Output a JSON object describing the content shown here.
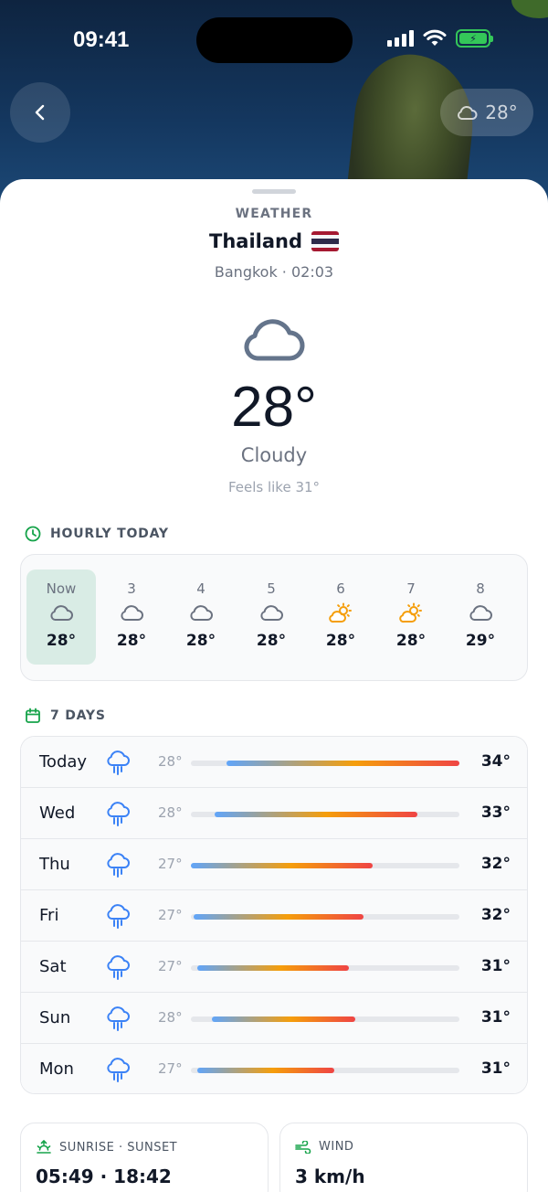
{
  "status_bar": {
    "time": "09:41"
  },
  "header": {
    "chip_temp": "28°"
  },
  "location": {
    "section_label": "WEATHER",
    "country": "Thailand",
    "city_time": "Bangkok · 02:03"
  },
  "current": {
    "temp": "28°",
    "condition": "Cloudy",
    "feels_like": "Feels like 31°"
  },
  "hourly": {
    "title": "HOURLY TODAY",
    "items": [
      {
        "label": "Now",
        "icon": "cloud-icon",
        "temp": "28°"
      },
      {
        "label": "3",
        "icon": "cloud-icon",
        "temp": "28°"
      },
      {
        "label": "4",
        "icon": "cloud-icon",
        "temp": "28°"
      },
      {
        "label": "5",
        "icon": "cloud-icon",
        "temp": "28°"
      },
      {
        "label": "6",
        "icon": "sun-cloud-icon",
        "temp": "28°"
      },
      {
        "label": "7",
        "icon": "sun-cloud-icon",
        "temp": "28°"
      },
      {
        "label": "8",
        "icon": "cloud-icon",
        "temp": "29°"
      }
    ]
  },
  "daily": {
    "title": "7 DAYS",
    "scale_min": 26,
    "scale_max": 35,
    "items": [
      {
        "day": "Today",
        "low": "28°",
        "high": "34°",
        "low_v": 27.2,
        "high_v": 35.0
      },
      {
        "day": "Wed",
        "low": "28°",
        "high": "33°",
        "low_v": 26.8,
        "high_v": 33.6
      },
      {
        "day": "Thu",
        "low": "27°",
        "high": "32°",
        "low_v": 26.0,
        "high_v": 32.1
      },
      {
        "day": "Fri",
        "low": "27°",
        "high": "32°",
        "low_v": 26.1,
        "high_v": 31.8
      },
      {
        "day": "Sat",
        "low": "27°",
        "high": "31°",
        "low_v": 26.2,
        "high_v": 31.3
      },
      {
        "day": "Sun",
        "low": "28°",
        "high": "31°",
        "low_v": 26.7,
        "high_v": 31.5
      },
      {
        "day": "Mon",
        "low": "27°",
        "high": "31°",
        "low_v": 26.2,
        "high_v": 30.8
      }
    ]
  },
  "sun": {
    "title": "SUNRISE · SUNSET",
    "value": "05:49 · 18:42"
  },
  "wind": {
    "title": "WIND",
    "value": "3 km/h"
  },
  "colors": {
    "accent_green": "#16a34a",
    "icon_gray": "#6b7280",
    "rain_blue": "#3b82f6",
    "sun_orange": "#f59e0b"
  }
}
